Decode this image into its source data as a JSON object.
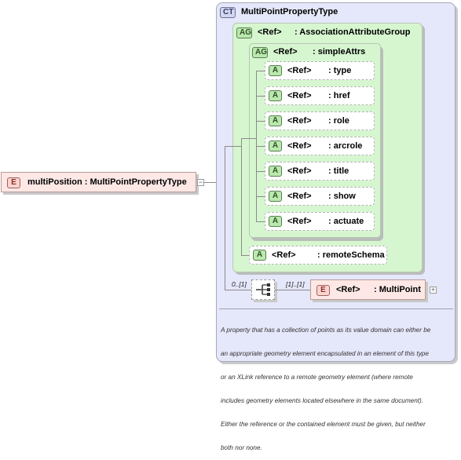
{
  "complex_type": {
    "badge": "CT",
    "name": "MultiPointPropertyType",
    "documentation_lines": [
      "A property that has a collection of points as its value domain can either be",
      "an appropriate geometry element encapsulated in an element of this type",
      "or an XLink reference to a remote geometry element (where remote",
      "includes geometry elements located elsewhere in the same document).",
      "Either the reference or the contained element must be given, but neither",
      "both nor none."
    ]
  },
  "attribute_group": {
    "badge": "AG",
    "ref": "<Ref>",
    "name": ": AssociationAttributeGroup"
  },
  "simple_attrs": {
    "badge": "AG",
    "ref": "<Ref>",
    "name": ": simpleAttrs"
  },
  "attributes": [
    {
      "badge": "A",
      "ref": "<Ref>",
      "name": ": type"
    },
    {
      "badge": "A",
      "ref": "<Ref>",
      "name": ": href"
    },
    {
      "badge": "A",
      "ref": "<Ref>",
      "name": ": role"
    },
    {
      "badge": "A",
      "ref": "<Ref>",
      "name": ": arcrole"
    },
    {
      "badge": "A",
      "ref": "<Ref>",
      "name": ": title"
    },
    {
      "badge": "A",
      "ref": "<Ref>",
      "name": ": show"
    },
    {
      "badge": "A",
      "ref": "<Ref>",
      "name": ": actuate"
    }
  ],
  "remote_schema": {
    "badge": "A",
    "ref": "<Ref>",
    "name": ": remoteSchema"
  },
  "root_element": {
    "badge": "E",
    "name": "multiPosition : MultiPointPropertyType",
    "collapse_symbol": "−"
  },
  "sequence": {
    "occurrence": "0..[1]"
  },
  "multipoint": {
    "badge": "E",
    "ref": "<Ref>",
    "name": ": MultiPoint",
    "occurrence": "[1]..[1]",
    "expand_symbol": "+"
  }
}
